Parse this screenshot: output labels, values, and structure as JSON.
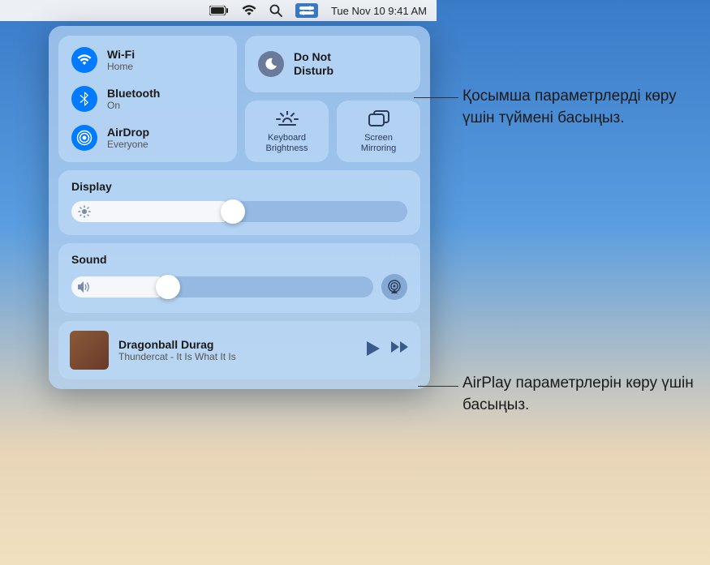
{
  "menubar": {
    "datetime": "Tue Nov 10  9:41 AM"
  },
  "connectivity": {
    "wifi": {
      "title": "Wi-Fi",
      "sub": "Home"
    },
    "bluetooth": {
      "title": "Bluetooth",
      "sub": "On"
    },
    "airdrop": {
      "title": "AirDrop",
      "sub": "Everyone"
    }
  },
  "dnd": {
    "title_line1": "Do Not",
    "title_line2": "Disturb"
  },
  "small": {
    "kb": "Keyboard\nBrightness",
    "mirror": "Screen\nMirroring"
  },
  "display": {
    "title": "Display",
    "value_pct": 48
  },
  "sound": {
    "title": "Sound",
    "value_pct": 32
  },
  "media": {
    "track": "Dragonball Durag",
    "artist": "Thundercat - It Is What It Is"
  },
  "callouts": {
    "c1": "Қосымша параметрлерді көру үшін түймені басыңыз.",
    "c2": "AirPlay параметрлерін көру үшін басыңыз."
  }
}
